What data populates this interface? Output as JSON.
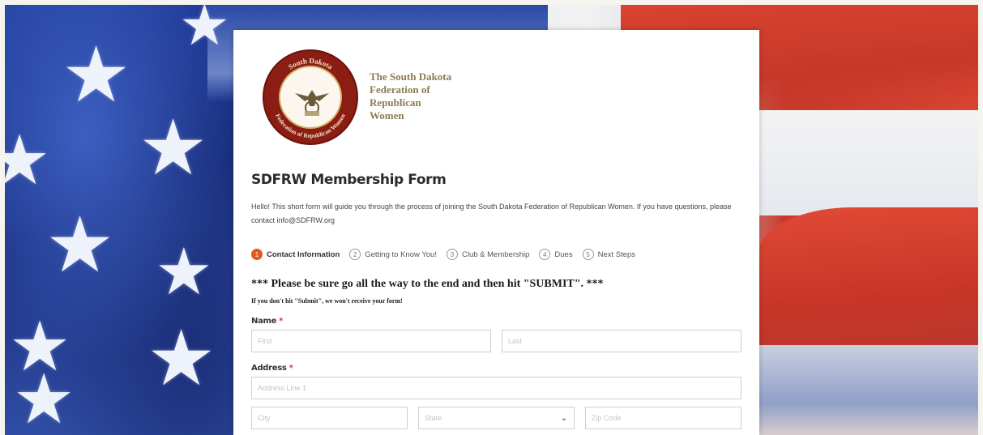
{
  "branding": {
    "logo_text_lines": [
      "The South Dakota",
      "Federation of",
      "Republican",
      "Women"
    ],
    "seal_text_top": "South Dakota",
    "seal_text_bottom": "Federation of Republican Women",
    "brand_color": "#8b1d14",
    "gold_color": "#8c7b54"
  },
  "form": {
    "title": "SDFRW Membership Form",
    "intro": "Hello! This short form will guide you through the process of joining the South Dakota Federation of Republican Women. If you have questions, please contact info@SDFRW.org",
    "steps": [
      {
        "num": "1",
        "label": "Contact Information",
        "active": true
      },
      {
        "num": "2",
        "label": "Getting to Know You!",
        "active": false
      },
      {
        "num": "3",
        "label": "Club & Membership",
        "active": false
      },
      {
        "num": "4",
        "label": "Dues",
        "active": false
      },
      {
        "num": "5",
        "label": "Next Steps",
        "active": false
      }
    ],
    "notice": "*** Please be sure go all the way to the end and then hit \"SUBMIT\". ***",
    "subnotice": "If you don't hit \"Submit\", we won't receive your form!",
    "name": {
      "label": "Name",
      "required_mark": "*",
      "first_placeholder": "First",
      "last_placeholder": "Last"
    },
    "address": {
      "label": "Address",
      "required_mark": "*",
      "line1_placeholder": "Address Line 1",
      "city_placeholder": "City",
      "state_placeholder": "State",
      "zip_placeholder": "Zip Code"
    },
    "accent_color": "#e2591d",
    "required_color": "#d9342b"
  },
  "icons": {
    "eagle": "eagle-icon",
    "chevron": "chevron-down-icon",
    "star": "star-icon"
  }
}
